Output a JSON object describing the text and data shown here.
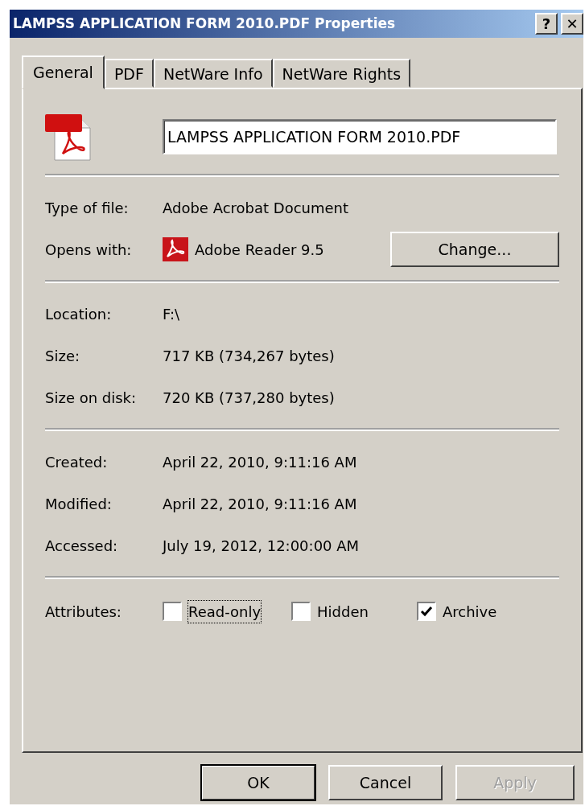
{
  "window": {
    "title": "LAMPSS APPLICATION FORM 2010.PDF Properties",
    "help_button": "?",
    "close_button": "✕"
  },
  "tabs": [
    {
      "label": "General",
      "selected": true
    },
    {
      "label": "PDF",
      "selected": false
    },
    {
      "label": "NetWare Info",
      "selected": false
    },
    {
      "label": "NetWare Rights",
      "selected": false
    }
  ],
  "file_name": "LAMPSS APPLICATION FORM 2010.PDF",
  "sections": [
    {
      "rows": [
        {
          "kind": "text",
          "label": "Type of file:",
          "value": "Adobe Acrobat Document"
        },
        {
          "kind": "app",
          "label": "Opens with:",
          "value": "Adobe Reader 9.5",
          "button": "Change..."
        }
      ]
    },
    {
      "rows": [
        {
          "kind": "text",
          "label": "Location:",
          "value": "F:\\"
        },
        {
          "kind": "text",
          "label": "Size:",
          "value": "717 KB (734,267 bytes)"
        },
        {
          "kind": "text",
          "label": "Size on disk:",
          "value": "720 KB (737,280 bytes)"
        }
      ]
    },
    {
      "rows": [
        {
          "kind": "text",
          "label": "Created:",
          "value": "April 22, 2010, 9:11:16 AM"
        },
        {
          "kind": "text",
          "label": "Modified:",
          "value": "April 22, 2010, 9:11:16 AM"
        },
        {
          "kind": "text",
          "label": "Accessed:",
          "value": "July 19, 2012, 12:00:00 AM"
        }
      ]
    }
  ],
  "attributes": {
    "label": "Attributes:",
    "items": [
      {
        "label": "Read-only",
        "checked": false,
        "focused": true
      },
      {
        "label": "Hidden",
        "checked": false,
        "focused": false
      },
      {
        "label": "Archive",
        "checked": true,
        "focused": false
      }
    ]
  },
  "buttons": [
    {
      "label": "OK",
      "default": true,
      "disabled": false
    },
    {
      "label": "Cancel",
      "default": false,
      "disabled": false
    },
    {
      "label": "Apply",
      "default": false,
      "disabled": true
    }
  ]
}
